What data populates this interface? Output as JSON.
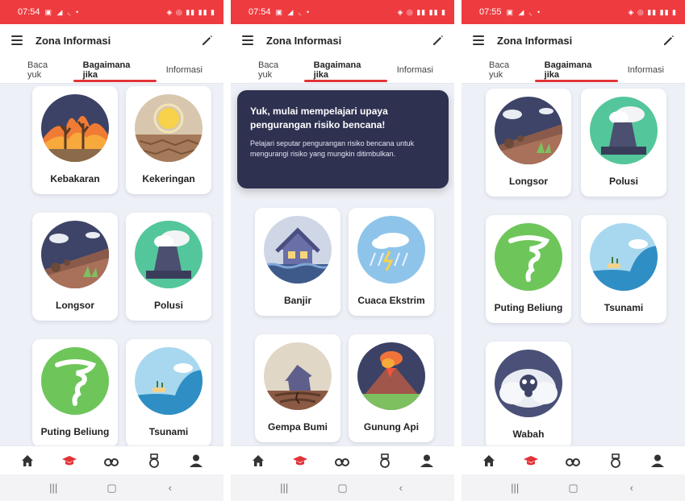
{
  "app_title": "Zona Informasi",
  "tabs": [
    "Baca yuk",
    "Bagaimana jika",
    "Informasi"
  ],
  "active_tab": "Bagaimana jika",
  "colors": {
    "accent": "#e23338",
    "status_bar": "#ee3b3f",
    "tooltip_bg": "#2e3150",
    "background": "#eef0f7"
  },
  "screens": [
    {
      "time": "07:54",
      "cards": [
        {
          "label": "Kebakaran",
          "illustration": "fire-illustration"
        },
        {
          "label": "Kekeringan",
          "illustration": "drought-illustration"
        },
        {
          "label": "Longsor",
          "illustration": "landslide-illustration"
        },
        {
          "label": "Polusi",
          "illustration": "pollution-illustration"
        },
        {
          "label": "Puting Beliung",
          "illustration": "tornado-illustration"
        },
        {
          "label": "Tsunami",
          "illustration": "tsunami-illustration"
        }
      ]
    },
    {
      "time": "07:54",
      "tooltip": {
        "title": "Yuk, mulai mempelajari upaya pengurangan risiko bencana!",
        "body": "Pelajari seputar pengurangan risiko bencana untuk mengurangi risiko yang mungkin ditimbulkan."
      },
      "cards": [
        {
          "label": "Banjir",
          "illustration": "flood-illustration"
        },
        {
          "label": "Cuaca Ekstrim",
          "illustration": "storm-illustration"
        },
        {
          "label": "Gempa Bumi",
          "illustration": "earthquake-illustration"
        },
        {
          "label": "Gunung Api",
          "illustration": "volcano-illustration"
        }
      ]
    },
    {
      "time": "07:55",
      "cards": [
        {
          "label": "Longsor",
          "illustration": "landslide-illustration"
        },
        {
          "label": "Polusi",
          "illustration": "pollution-illustration"
        },
        {
          "label": "Puting Beliung",
          "illustration": "tornado-illustration"
        },
        {
          "label": "Tsunami",
          "illustration": "tsunami-illustration"
        },
        {
          "label": "Wabah",
          "illustration": "epidemic-illustration"
        }
      ]
    }
  ],
  "bottom_nav": [
    "home-icon",
    "graduation-cap-icon",
    "binoculars-icon",
    "medal-icon",
    "profile-icon"
  ],
  "active_nav": "graduation-cap-icon",
  "system_nav": [
    "recent-apps-icon",
    "home-button-icon",
    "back-icon"
  ]
}
